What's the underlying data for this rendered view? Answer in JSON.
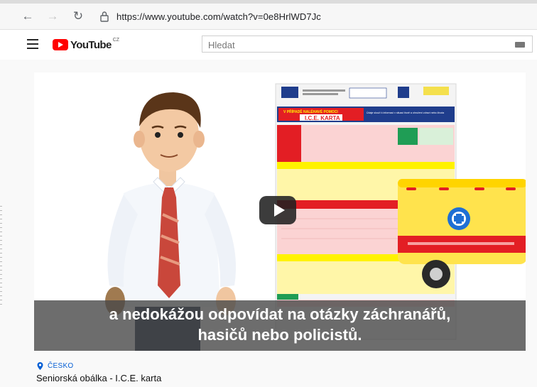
{
  "browser": {
    "url": "https://www.youtube.com/watch?v=0e8HrlWD7Jc",
    "back_icon": "arrow-left-icon",
    "forward_icon": "arrow-right-icon",
    "reload_icon": "reload-icon",
    "lock_icon": "lock-icon"
  },
  "header": {
    "menu_icon": "hamburger-menu-icon",
    "logo_text": "YouTube",
    "logo_country": "CZ",
    "search_placeholder": "Hledat",
    "keyboard_icon": "keyboard-icon"
  },
  "video": {
    "subtitle_line1": "a nedokážou odpovídat na otázky záchranářů,",
    "subtitle_line2": "hasičů nebo policistů.",
    "card_header": "I.C.E. KARTA",
    "card_prefix": "V PŘÍPADĚ NALÉHAVÉ POMOCI",
    "card_note": "Údaje slouží k informaci v situaci tísně a ohrožení zdraví nebo života",
    "play_icon": "play-icon"
  },
  "info": {
    "location": "ČESKO",
    "title": "Seniorská obálka - I.C.E. karta"
  },
  "colors": {
    "youtube_red": "#ff0000",
    "card_red": "#e31e24",
    "card_yellow": "#fff200",
    "card_blue": "#1f3d8c",
    "link_blue": "#065fd4"
  }
}
